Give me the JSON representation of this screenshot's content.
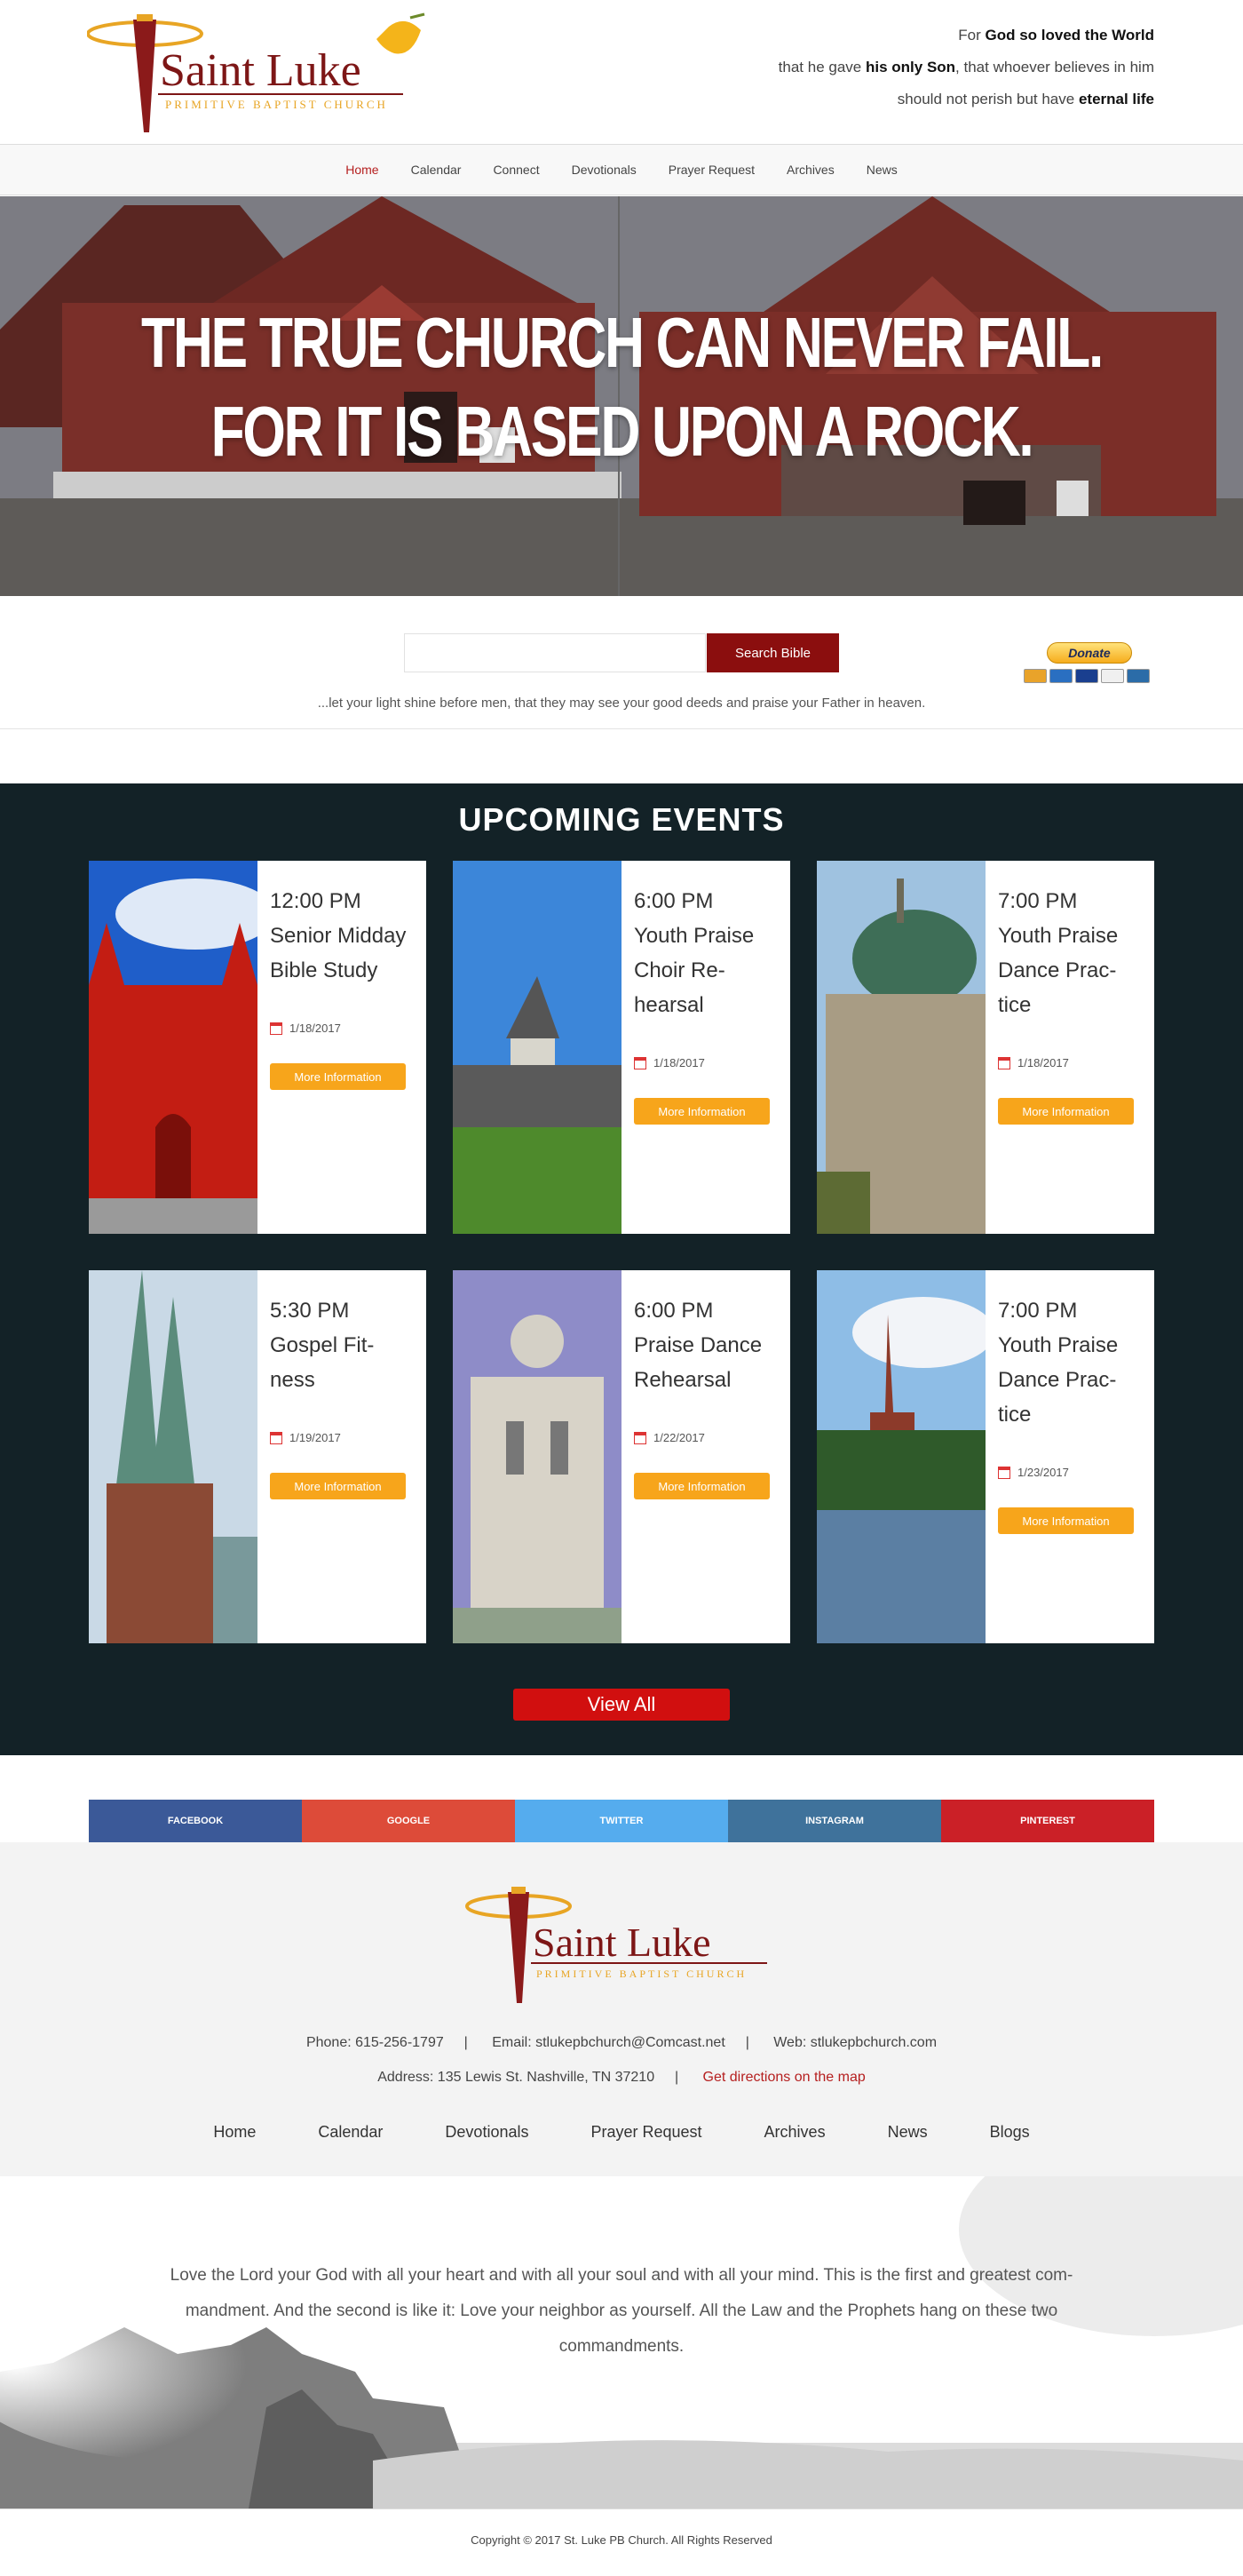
{
  "header": {
    "logo_title": "Saint Luke",
    "logo_subtitle": "Primitive Baptist Church",
    "verse": {
      "l1a": "For ",
      "l1b": "God so loved the World",
      "l2a": "that he gave ",
      "l2b": "his only Son",
      "l2c": ", that whoever believes in him",
      "l3a": "should not perish but have ",
      "l3b": "eternal life"
    }
  },
  "nav": [
    "Home",
    "Calendar",
    "Connect",
    "Devotionals",
    "Prayer Request",
    "Archives",
    "News"
  ],
  "hero": {
    "line1": "THE TRUE CHURCH CAN NEVER FAIL.",
    "line2": "FOR IT IS BASED UPON A ROCK."
  },
  "search": {
    "value": "",
    "button": "Search Bible",
    "donate": "Donate",
    "tagline": "...let your light shine before men, that they may see your good deeds and praise your Father in heaven."
  },
  "events": {
    "title": "UPCOMING EVENTS",
    "more_label": "More Information",
    "items": [
      {
        "time": "12:00 PM",
        "name": "Senior Midday Bible Study",
        "date": "1/18/2017"
      },
      {
        "time": "6:00 PM",
        "name": "Youth Praise Choir Re-hearsal",
        "date": "1/18/2017"
      },
      {
        "time": "7:00 PM",
        "name": "Youth Praise Dance Prac-tice",
        "date": "1/18/2017"
      },
      {
        "time": "5:30 PM",
        "name": "Gospel Fit-ness",
        "date": "1/19/2017"
      },
      {
        "time": "6:00 PM",
        "name": "Praise Dance Rehearsal",
        "date": "1/22/2017"
      },
      {
        "time": "7:00 PM",
        "name": "Youth Praise Dance Prac-tice",
        "date": "1/23/2017"
      }
    ],
    "view_all": "View All"
  },
  "social": [
    {
      "label": "FACEBOOK",
      "color": "#3b5998"
    },
    {
      "label": "GOOGLE",
      "color": "#dd4b39"
    },
    {
      "label": "TWITTER",
      "color": "#55acee"
    },
    {
      "label": "INSTAGRAM",
      "color": "#3f729b"
    },
    {
      "label": "PINTEREST",
      "color": "#cb2027"
    }
  ],
  "footer": {
    "phone": "Phone: 615-256-1797",
    "email": "Email:  stlukepbchurch@Comcast.net",
    "web": "Web: stlukepbchurch.com",
    "address": "Address:  135 Lewis St. Nashville, TN 37210",
    "directions": "Get directions on the map",
    "nav": [
      "Home",
      "Calendar",
      "Devotionals",
      "Prayer Request",
      "Archives",
      "News",
      "Blogs"
    ]
  },
  "quote": "Love the Lord your God with all your heart and with all your soul and with all your mind. This is the first and greatest com-mandment. And the second is like it: Love your neighbor as yourself. All the Law and the Prophets hang on these two commandments.",
  "copyright": "Copyright © 2017  St. Luke PB Church. All Rights Reserved",
  "colors": {
    "accent": "#8b0e0e",
    "events_bg": "#132227",
    "button_orange": "#f7a51b",
    "view_all_red": "#d10f0f"
  }
}
